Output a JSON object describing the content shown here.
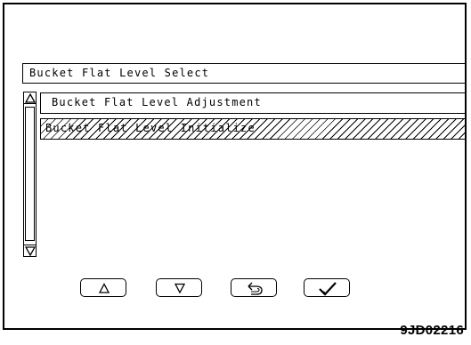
{
  "screen": {
    "title": "Bucket Flat Level Select",
    "menu_items": [
      {
        "label": "Bucket Flat Level Adjustment",
        "selected": false
      },
      {
        "label": "Bucket Flat Level Initialize",
        "selected": true
      }
    ],
    "scrollbar": {
      "up_icon": "triangle-up-icon",
      "down_icon": "triangle-down-icon"
    },
    "buttons": [
      {
        "icon": "arrow-up-icon"
      },
      {
        "icon": "arrow-down-icon"
      },
      {
        "icon": "return-icon"
      },
      {
        "icon": "checkmark-icon"
      }
    ]
  },
  "figure_code": "9JD02216"
}
